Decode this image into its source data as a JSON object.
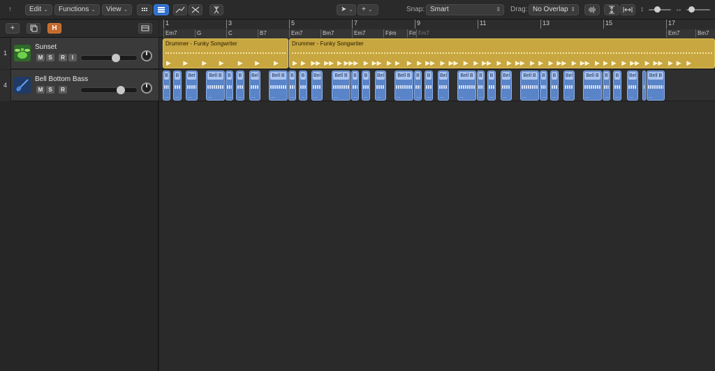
{
  "toolbar": {
    "edit_label": "Edit",
    "functions_label": "Functions",
    "view_label": "View",
    "snap_label": "Snap:",
    "snap_value": "Smart",
    "drag_label": "Drag:",
    "drag_value": "No Overlap"
  },
  "track_header": {
    "add_label": "+",
    "h_label": "H"
  },
  "tracks": [
    {
      "number": "1",
      "name": "Sunset",
      "buttons": [
        "M",
        "S",
        "R",
        "I"
      ],
      "icon": "drum-kit-icon"
    },
    {
      "number": "4",
      "name": "Bell Bottom Bass",
      "buttons": [
        "M",
        "S",
        "R"
      ],
      "icon": "bass-guitar-icon"
    }
  ],
  "ruler": {
    "bars": [
      "1",
      "3",
      "5",
      "7",
      "9",
      "11",
      "13",
      "15",
      "17"
    ],
    "chords": [
      "Em7",
      "G",
      "C",
      "B7",
      "Em7",
      "Bm7",
      "Em7",
      "F♯m",
      "Fm",
      "Fm7",
      "Em7",
      "Bm7"
    ]
  },
  "regions": {
    "drummer_label": "Drummer - Funky Songwriter",
    "bass_full_label": "Bell B",
    "bass_short_label": "B",
    "bass_tiny_label": "Bel"
  },
  "colors": {
    "drummer_region": "#c8a640",
    "bass_region": "#5a84c8",
    "accent_blue": "#2f6fd0",
    "h_button": "#c46a2c"
  }
}
